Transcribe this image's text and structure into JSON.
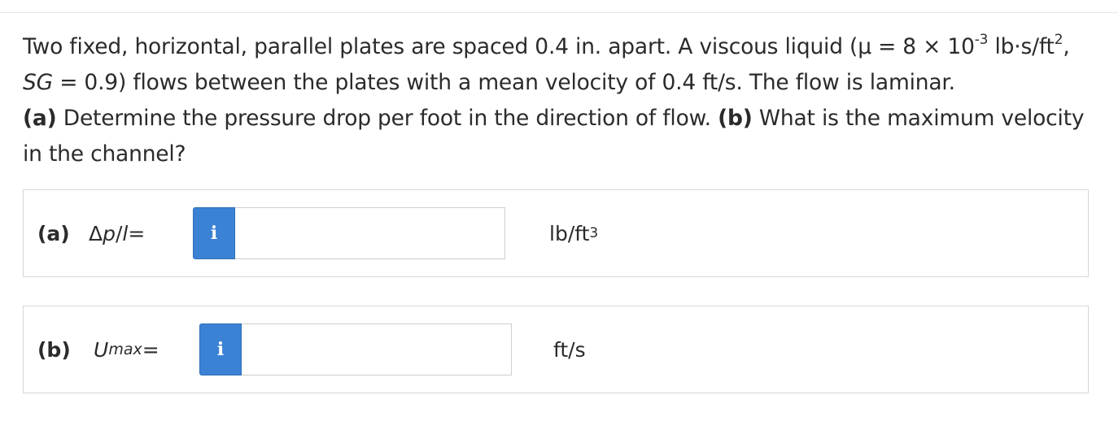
{
  "question": {
    "p1": "Two fixed, horizontal, parallel plates are spaced 0.4 in. apart. A viscous liquid (μ = 8 × 10",
    "exp1": "-3",
    "p2": " lb·s/ft",
    "exp2": "2",
    "p3": ", ",
    "sg_symbol": "SG",
    "p4": " = 0.9) flows between the plates with a mean velocity of 0.4 ft/s. The flow is laminar. ",
    "part_a_tag": "(a)",
    "p5": " Determine the pressure drop per foot in the direction of flow. ",
    "part_b_tag": "(b)",
    "p6": " What is the maximum velocity in the channel?"
  },
  "answers": [
    {
      "part_label": "(a)",
      "formula_prefix": "Δ",
      "formula_var1": "p",
      "formula_slash": "/",
      "formula_var2": "l",
      "formula_eq": " =",
      "info_icon": "i",
      "input_value": "",
      "unit_base": "lb/ft",
      "unit_exp": "3"
    },
    {
      "part_label": "(b)",
      "formula_var": "U",
      "formula_sub": "max",
      "formula_eq": " =",
      "info_icon": "i",
      "input_value": "",
      "unit_base": "ft/s"
    }
  ],
  "colors": {
    "info_button": "#3b82d4",
    "border": "#d7d7d7",
    "text": "#2b2b2b"
  },
  "icons": {
    "info": "info-icon"
  }
}
